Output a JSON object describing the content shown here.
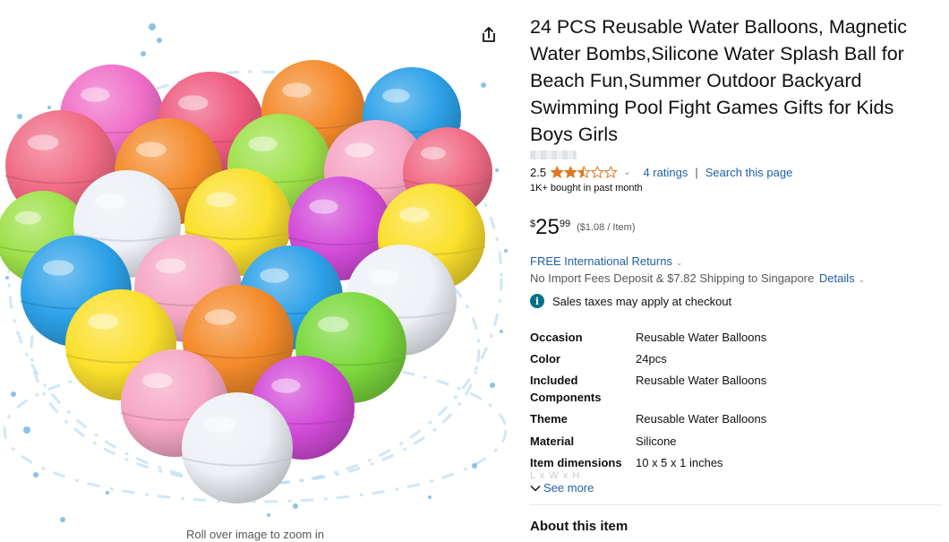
{
  "image": {
    "caption": "Roll over image to zoom in",
    "share_icon": "share-icon",
    "ball_colors": {
      "pink": "#f06fc8",
      "magenta": "#d34bd9",
      "rose": "#ee5a7e",
      "coral": "#f06b85",
      "orange": "#f48a2a",
      "lime": "#9ee14a",
      "green": "#7bd93d",
      "light_pink": "#f6a7c4",
      "yellow": "#fbe02c",
      "blue": "#2da1e8",
      "white": "#eef1f6"
    }
  },
  "product": {
    "title": "24 PCS Reusable Water Balloons, Magnetic Water Bombs,Silicone Water Splash Ball for Beach Fun,Summer Outdoor Backyard Swimming Pool Fight Games Gifts for Kids Boys Girls",
    "rating_value": "2.5",
    "rating_stars": 2.5,
    "rating_max": 5,
    "star_color": "#de7921",
    "ratings_count": "4 ratings",
    "separator": "|",
    "search_page": "Search this page",
    "bought": "1K+ bought in past month"
  },
  "price": {
    "currency": "$",
    "whole": "25",
    "fraction": "99",
    "per_unit": "($1.08 / Item)"
  },
  "delivery": {
    "returns": "FREE International Returns",
    "shipping": "No Import Fees Deposit & $7.82 Shipping to Singapore",
    "details": "Details",
    "tax_notice": "Sales taxes may apply at checkout",
    "info_icon_glyph": "i"
  },
  "specs": [
    {
      "label": "Occasion",
      "value": "Reusable Water Balloons"
    },
    {
      "label": "Color",
      "value": "24pcs"
    },
    {
      "label": "Included Components",
      "value": "Reusable Water Balloons"
    },
    {
      "label": "Theme",
      "value": "Reusable Water Balloons"
    },
    {
      "label": "Material",
      "value": "Silicone"
    },
    {
      "label": "Item dimensions",
      "value": "10 x 5 x 1 inches"
    }
  ],
  "spec_overflow_hint": "L x W x H",
  "see_more": "See more",
  "about_heading": "About this item"
}
